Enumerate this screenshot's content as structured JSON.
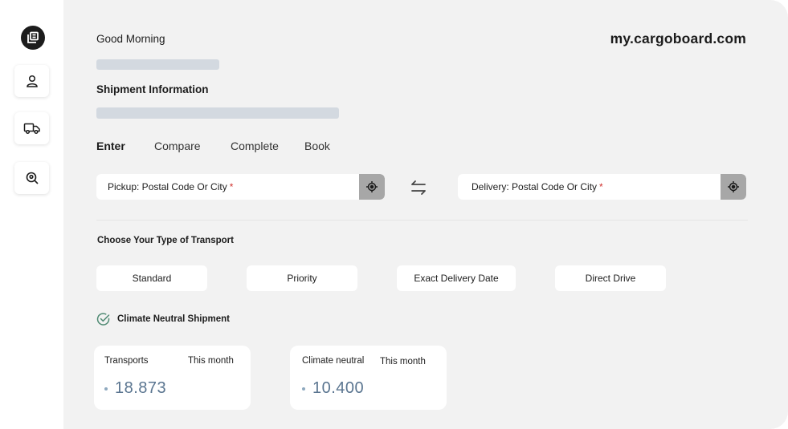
{
  "sidebar": {
    "logo_icon": "logo-icon",
    "items": [
      {
        "name": "profile",
        "icon": "user-icon"
      },
      {
        "name": "transport",
        "icon": "truck-icon"
      },
      {
        "name": "track",
        "icon": "location-search-icon"
      }
    ]
  },
  "header": {
    "greeting": "Good Morning",
    "domain": "my.cargoboard.com"
  },
  "shipment": {
    "title": "Shipment Information",
    "steps": [
      "Enter",
      "Compare",
      "Complete",
      "Book"
    ],
    "active_step": "Enter"
  },
  "pickup": {
    "label": "Pickup: Postal Code Or City",
    "required_mark": "*",
    "icon": "locate-icon"
  },
  "swap_icon": "swap-arrows-icon",
  "delivery": {
    "label": "Delivery: Postal Code Or City",
    "required_mark": "*",
    "icon": "locate-icon"
  },
  "transport": {
    "title": "Choose Your Type of Transport",
    "options": [
      "Standard",
      "Priority",
      "Exact Delivery Date",
      "Direct Drive"
    ]
  },
  "climate_neutral": {
    "label": "Climate Neutral Shipment",
    "checked": true,
    "icon": "check-circle-icon"
  },
  "stats": [
    {
      "label": "Transports",
      "period": "This month",
      "value": "18.873"
    },
    {
      "label": "Climate neutral",
      "period": "This month",
      "value": "10.400"
    }
  ],
  "colors": {
    "background": "#f2f2f2",
    "placeholder_bar": "#d3d9e0",
    "locate_button": "#a7a7a7",
    "stat_value": "#5a7590",
    "required": "#d0312d",
    "check": "#4f8a73"
  }
}
